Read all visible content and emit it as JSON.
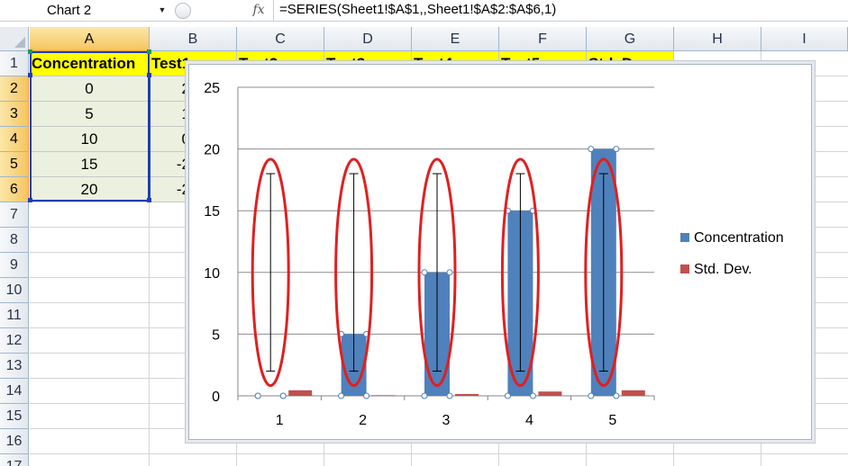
{
  "formula_bar": {
    "name_box": "Chart 2",
    "fx_label": "fx",
    "formula": "=SERIES(Sheet1!$A$1,,Sheet1!$A$2:$A$6,1)"
  },
  "columns": [
    "A",
    "B",
    "C",
    "D",
    "E",
    "F",
    "G",
    "H",
    "I"
  ],
  "rows": [
    "1",
    "2",
    "3",
    "4",
    "5",
    "6",
    "7",
    "8",
    "9",
    "10",
    "11",
    "12",
    "13",
    "14",
    "15",
    "16",
    "17"
  ],
  "sheet": {
    "header_row": [
      "Concentration",
      "Test1",
      "Test2",
      "Test3",
      "Test4",
      "Test5",
      "Std. Dev."
    ],
    "col_a_values": [
      "0",
      "5",
      "10",
      "15",
      "20"
    ],
    "col_b_partial": [
      "2",
      "1",
      "0",
      "-2",
      "-2"
    ]
  },
  "chart_data": {
    "type": "bar",
    "categories": [
      "1",
      "2",
      "3",
      "4",
      "5"
    ],
    "series": [
      {
        "name": "Concentration",
        "values": [
          0,
          5,
          10,
          15,
          20
        ],
        "color": "#4f81bd"
      },
      {
        "name": "Std. Dev.",
        "values": [
          0.45,
          0.05,
          0.15,
          0.35,
          0.45
        ],
        "color": "#c0504d"
      }
    ],
    "error_bars": {
      "series": "Concentration",
      "low": 2,
      "high": 18,
      "color": "#000000"
    },
    "highlight_ellipses": {
      "color": "#e02020",
      "count": 5
    },
    "ylim": [
      0,
      25
    ],
    "yticks": [
      "0",
      "5",
      "10",
      "15",
      "20",
      "25"
    ],
    "grid": true,
    "legend_position": "right",
    "title": "",
    "xlabel": "",
    "ylabel": ""
  },
  "colors": {
    "header_fill": "#ffff00",
    "data_fill": "#ebf1de",
    "selection": "#1f3eb8"
  }
}
